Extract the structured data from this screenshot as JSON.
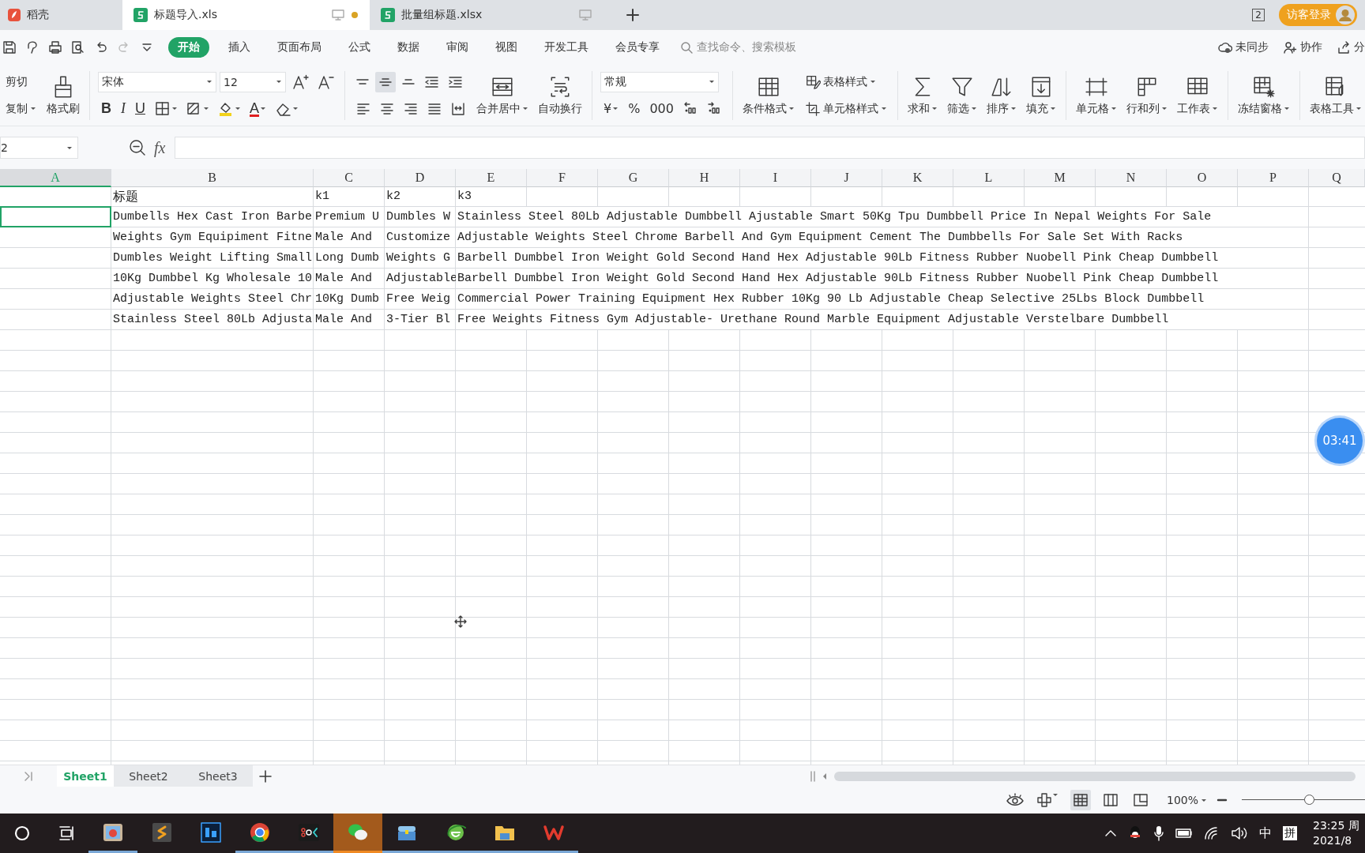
{
  "tabs": [
    {
      "kind": "home",
      "label": "稻壳",
      "selected": false
    },
    {
      "kind": "doc",
      "label": "标题导入.xls",
      "selected": true,
      "modified": true
    },
    {
      "kind": "doc",
      "label": "批量组标题.xlsx",
      "selected": false,
      "modified": false
    }
  ],
  "window_count": "2",
  "login_button": "访客登录",
  "menu": [
    {
      "label": "开始",
      "selected": true
    },
    {
      "label": "插入",
      "selected": false
    },
    {
      "label": "页面布局",
      "selected": false
    },
    {
      "label": "公式",
      "selected": false
    },
    {
      "label": "数据",
      "selected": false
    },
    {
      "label": "审阅",
      "selected": false
    },
    {
      "label": "视图",
      "selected": false
    },
    {
      "label": "开发工具",
      "selected": false
    },
    {
      "label": "会员专享",
      "selected": false
    }
  ],
  "search": {
    "placeholder": "查找命令、搜索模板"
  },
  "header_actions": [
    {
      "kind": "sync",
      "label": "未同步"
    },
    {
      "kind": "collab",
      "label": "协作"
    },
    {
      "kind": "share",
      "label": "分"
    }
  ],
  "ribbon": [
    {
      "kind": "rows",
      "top": [
        {
          "kind": "text",
          "label": "剪切",
          "dropdown": false
        }
      ],
      "bottom": [
        {
          "kind": "text",
          "label": "复制",
          "dropdown": true
        }
      ]
    },
    {
      "kind": "large",
      "items": [
        {
          "label": "格式刷",
          "dropdown": false
        }
      ]
    },
    {
      "kind": "divider"
    },
    {
      "kind": "rows",
      "top": [
        {
          "kind": "select",
          "value": "宋体"
        },
        {
          "kind": "select",
          "value": "12"
        },
        {
          "kind": "icon",
          "dropdown": false
        },
        {
          "kind": "icon",
          "dropdown": false
        }
      ],
      "bottom": [
        {
          "kind": "bold",
          "label": "B",
          "dropdown": false
        },
        {
          "kind": "italic",
          "label": "I",
          "dropdown": false
        },
        {
          "kind": "underline",
          "label": "U",
          "dropdown": false
        },
        {
          "kind": "icon",
          "dropdown": true
        },
        {
          "kind": "icon",
          "dropdown": true
        },
        {
          "kind": "icon",
          "dropdown": true
        },
        {
          "kind": "fontcolor",
          "label": "A",
          "dropdown": true
        },
        {
          "kind": "icon",
          "dropdown": true
        }
      ]
    },
    {
      "kind": "divider"
    },
    {
      "kind": "rows",
      "top": [
        {
          "kind": "icon",
          "dropdown": false,
          "selected": false
        },
        {
          "kind": "icon",
          "dropdown": false,
          "selected": true
        },
        {
          "kind": "icon",
          "dropdown": false,
          "selected": false
        },
        {
          "kind": "icon",
          "dropdown": false,
          "selected": false
        },
        {
          "kind": "icon",
          "dropdown": false,
          "selected": false
        }
      ],
      "bottom": [
        {
          "kind": "icon",
          "dropdown": false,
          "selected": false
        },
        {
          "kind": "icon",
          "dropdown": false,
          "selected": false
        },
        {
          "kind": "icon",
          "dropdown": false,
          "selected": false
        },
        {
          "kind": "icon",
          "dropdown": false,
          "selected": false
        },
        {
          "kind": "icon",
          "dropdown": false,
          "selected": false
        }
      ]
    },
    {
      "kind": "large",
      "items": [
        {
          "label": "合并居中",
          "dropdown": true
        },
        {
          "label": "自动换行",
          "dropdown": false
        }
      ]
    },
    {
      "kind": "divider"
    },
    {
      "kind": "rows",
      "top": [
        {
          "kind": "select",
          "value": "常规"
        }
      ],
      "bottom": [
        {
          "kind": "glyph",
          "label": "¥",
          "dropdown": true
        },
        {
          "kind": "glyph",
          "label": "%",
          "dropdown": false
        },
        {
          "kind": "glyph",
          "label": "000",
          "dropdown": false
        },
        {
          "kind": "icon",
          "dropdown": false
        },
        {
          "kind": "icon",
          "dropdown": false
        }
      ]
    },
    {
      "kind": "divider"
    },
    {
      "kind": "large",
      "items": [
        {
          "label": "条件格式",
          "dropdown": true
        }
      ]
    },
    {
      "kind": "rows",
      "top": [
        {
          "kind": "small",
          "label": "表格样式",
          "dropdown": true
        }
      ],
      "bottom": [
        {
          "kind": "small",
          "label": "单元格样式",
          "dropdown": true
        }
      ]
    },
    {
      "kind": "divider"
    },
    {
      "kind": "large",
      "items": [
        {
          "label": "求和",
          "dropdown": true
        },
        {
          "label": "筛选",
          "dropdown": true
        },
        {
          "label": "排序",
          "dropdown": true
        },
        {
          "label": "填充",
          "dropdown": true
        }
      ]
    },
    {
      "kind": "divider"
    },
    {
      "kind": "large",
      "items": [
        {
          "label": "单元格",
          "dropdown": true
        },
        {
          "label": "行和列",
          "dropdown": true
        },
        {
          "label": "工作表",
          "dropdown": true
        }
      ]
    },
    {
      "kind": "divider"
    },
    {
      "kind": "large",
      "items": [
        {
          "label": "冻结窗格",
          "dropdown": true
        }
      ]
    },
    {
      "kind": "divider"
    },
    {
      "kind": "large",
      "items": [
        {
          "label": "表格工具",
          "dropdown": true
        }
      ]
    }
  ],
  "name_box": "2",
  "formula": {
    "fx": "fx"
  },
  "columns": [
    {
      "label": "A",
      "selected": true
    },
    {
      "label": "B",
      "selected": false
    },
    {
      "label": "C",
      "selected": false
    },
    {
      "label": "D",
      "selected": false
    },
    {
      "label": "E",
      "selected": false
    },
    {
      "label": "F",
      "selected": false
    },
    {
      "label": "G",
      "selected": false
    },
    {
      "label": "H",
      "selected": false
    },
    {
      "label": "I",
      "selected": false
    },
    {
      "label": "J",
      "selected": false
    },
    {
      "label": "K",
      "selected": false
    },
    {
      "label": "L",
      "selected": false
    },
    {
      "label": "M",
      "selected": false
    },
    {
      "label": "N",
      "selected": false
    },
    {
      "label": "O",
      "selected": false
    },
    {
      "label": "P",
      "selected": false
    },
    {
      "label": "Q",
      "selected": false
    }
  ],
  "rows": [
    {
      "selected": false,
      "cells": [
        "",
        "标题",
        "k1",
        "k2",
        "k3"
      ]
    },
    {
      "selected": true,
      "cells": [
        "",
        "Dumbells Hex Cast Iron Barbe",
        "Premium U",
        "Dumbles W",
        "Stainless Steel 80Lb Adjustable Dumbbell Ajustable Smart 50Kg Tpu Dumbbell Price In Nepal Weights For Sale"
      ]
    },
    {
      "selected": false,
      "cells": [
        "",
        "Weights Gym Equipiment Fitne",
        "Male And",
        "Customize",
        "Adjustable Weights Steel Chrome Barbell And Gym Equipment Cement The Dumbbells For Sale Set With Racks"
      ]
    },
    {
      "selected": false,
      "cells": [
        "",
        "Dumbles Weight Lifting Small",
        "Long Dumb",
        "Weights G",
        "Barbell Dumbbel Iron Weight Gold Second Hand Hex Adjustable 90Lb Fitness Rubber Nuobell Pink Cheap Dumbbell"
      ]
    },
    {
      "selected": false,
      "cells": [
        "",
        "10Kg Dumbbel Kg Wholesale 10",
        "Male And",
        "Adjustable",
        "Barbell Dumbbel Iron Weight Gold Second Hand Hex Adjustable 90Lb Fitness Rubber Nuobell Pink Cheap Dumbbell"
      ]
    },
    {
      "selected": false,
      "cells": [
        "",
        "Adjustable Weights Steel Chr",
        "10Kg Dumb",
        "Free Weig",
        "Commercial Power Training Equipment Hex Rubber 10Kg 90 Lb Adjustable Cheap Selective 25Lbs Block Dumbbell"
      ]
    },
    {
      "selected": false,
      "cells": [
        "",
        "Stainless Steel 80Lb Adjusta",
        "Male And",
        "3-Tier Bl",
        "Free Weights Fitness Gym Adjustable- Urethane Round Marble Equipment Adjustable Verstelbare Dumbbell"
      ]
    }
  ],
  "timer": "03:41",
  "sheets": [
    {
      "label": "Sheet1",
      "selected": true
    },
    {
      "label": "Sheet2",
      "selected": false
    },
    {
      "label": "Sheet3",
      "selected": false
    }
  ],
  "status": {
    "zoom": "100%",
    "zoom_slider": {
      "level": 0.55
    }
  },
  "taskbar": {
    "apps": [
      {
        "running": true,
        "selected": false
      },
      {
        "running": false,
        "selected": false
      },
      {
        "running": false,
        "selected": false
      },
      {
        "running": true,
        "selected": false
      },
      {
        "running": true,
        "selected": false
      },
      {
        "running": true,
        "selected": true
      },
      {
        "running": true,
        "selected": false
      },
      {
        "running": true,
        "selected": false
      },
      {
        "running": true,
        "selected": false
      },
      {
        "running": true,
        "selected": false
      }
    ],
    "ime": [
      "中",
      "拼"
    ],
    "time": "23:25 周",
    "date": "2021/8"
  }
}
